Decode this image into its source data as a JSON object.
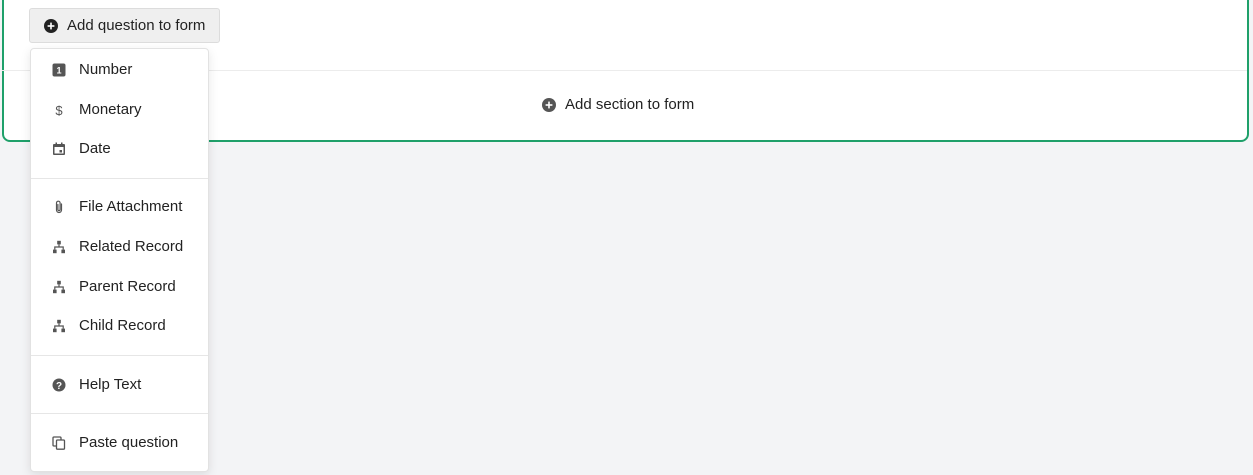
{
  "toolbar": {
    "add_question_label": "Add question to form"
  },
  "form": {
    "add_section_label": "Add section to form"
  },
  "menu": {
    "items": [
      {
        "label": "Number",
        "icon": "number-icon"
      },
      {
        "label": "Monetary",
        "icon": "dollar-icon"
      },
      {
        "label": "Date",
        "icon": "calendar-icon"
      },
      {
        "label": "File Attachment",
        "icon": "paperclip-icon"
      },
      {
        "label": "Related Record",
        "icon": "hierarchy-icon"
      },
      {
        "label": "Parent Record",
        "icon": "hierarchy-icon"
      },
      {
        "label": "Child Record",
        "icon": "hierarchy-icon"
      },
      {
        "label": "Help Text",
        "icon": "help-icon"
      },
      {
        "label": "Paste question",
        "icon": "copy-icon"
      }
    ]
  },
  "colors": {
    "card_border": "#1fa06a",
    "background": "#f3f4f6",
    "icon": "#555555"
  }
}
